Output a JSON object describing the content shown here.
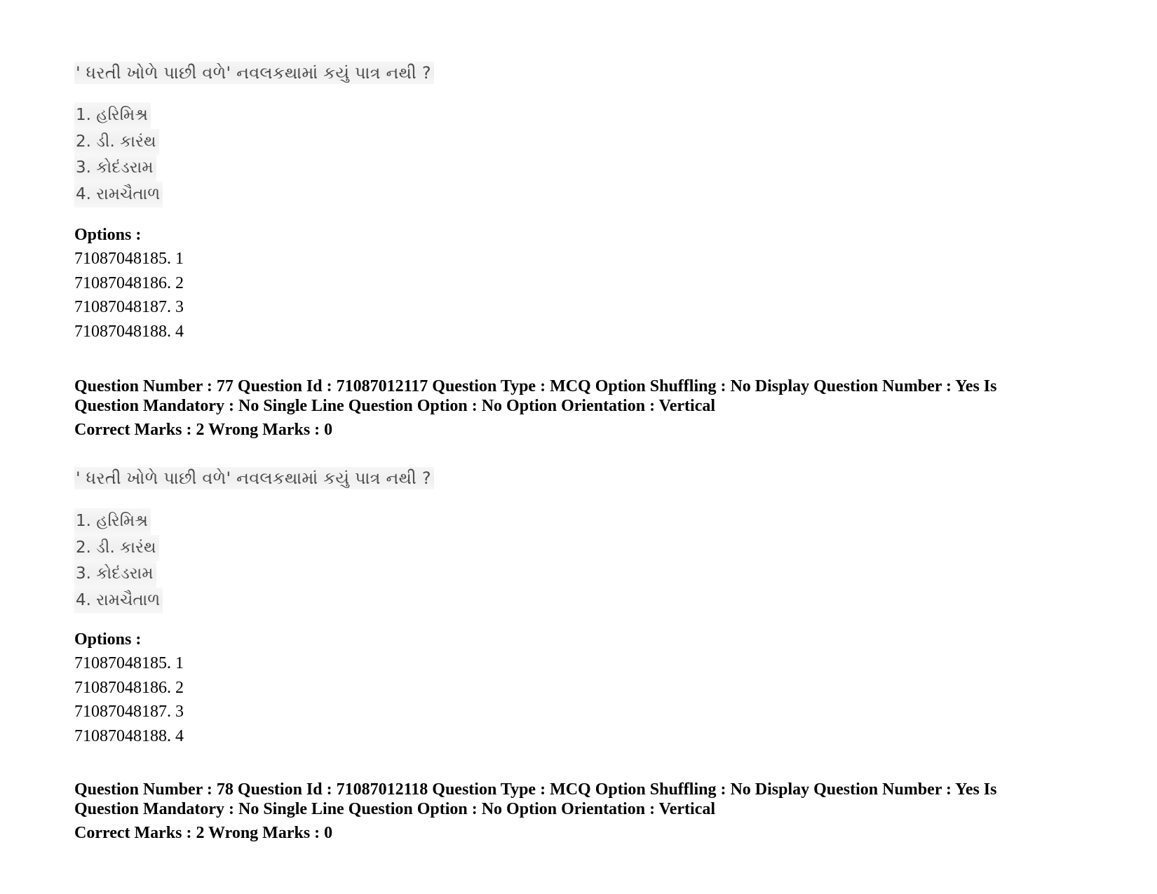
{
  "document": {
    "blocks": [
      {
        "type": "question-content",
        "question_text": "' ધરતી ખોળે પાછી વળે' નવલકથામાં કયું પાત્ર નથી ?",
        "choices": [
          "1. હરિમિશ્ર",
          "2. ડી. કારંથ",
          "3. કોદંડરામ",
          "4. રામચૈતાળ"
        ],
        "options_label": "Options :",
        "options": [
          "71087048185. 1",
          "71087048186. 2",
          "71087048187. 3",
          "71087048188. 4"
        ]
      },
      {
        "type": "question-header",
        "meta_line_1": "Question Number : 77 Question Id : 71087012117 Question Type : MCQ Option Shuffling : No Display Question Number : Yes Is",
        "meta_line_2": "Question Mandatory : No Single Line Question Option : No Option Orientation : Vertical",
        "marks_line": "Correct Marks : 2 Wrong Marks : 0",
        "question_number": "77",
        "question_id": "71087012117"
      },
      {
        "type": "question-content",
        "question_text": "' ધરતી ખોળે પાછી વળે' નવલકથામાં કયું પાત્ર નથી ?",
        "choices": [
          "1. હરિમિશ્ર",
          "2. ડી. કારંથ",
          "3. કોદંડરામ",
          "4. રામચૈતાળ"
        ],
        "options_label": "Options :",
        "options": [
          "71087048185. 1",
          "71087048186. 2",
          "71087048187. 3",
          "71087048188. 4"
        ]
      },
      {
        "type": "question-header",
        "meta_line_1": "Question Number : 78 Question Id : 71087012118 Question Type : MCQ Option Shuffling : No Display Question Number : Yes Is",
        "meta_line_2": "Question Mandatory : No Single Line Question Option : No Option Orientation : Vertical",
        "marks_line": "Correct Marks : 2 Wrong Marks : 0",
        "question_number": "78",
        "question_id": "71087012118"
      }
    ]
  }
}
